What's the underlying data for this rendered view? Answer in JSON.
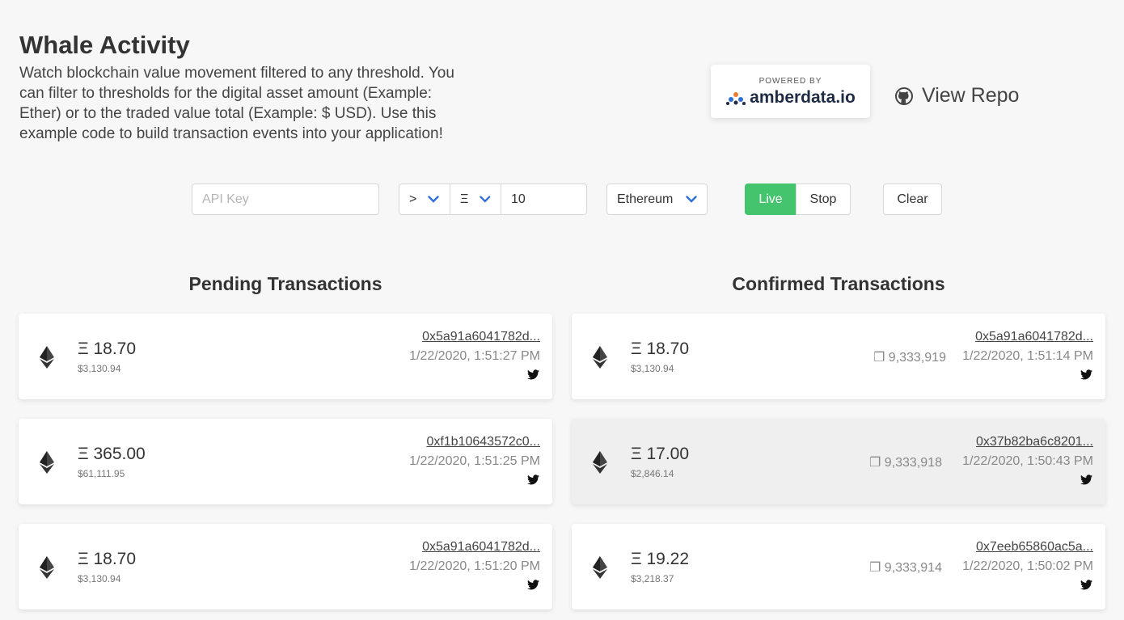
{
  "header": {
    "title": "Whale Activity",
    "description": "Watch blockchain value movement filtered to any threshold. You can filter to thresholds for the digital asset amount (Example: Ether) or to the traded value total (Example: $ USD). Use this example code to build transaction events into your application!"
  },
  "powered": {
    "small": "POWERED BY",
    "brand": "amberdata.io"
  },
  "repo": {
    "label": "View Repo",
    "icon": "github-icon"
  },
  "filters": {
    "api_key_placeholder": "API Key",
    "operator": ">",
    "unit": "Ξ",
    "threshold": "10",
    "network": "Ethereum",
    "live_label": "Live",
    "stop_label": "Stop",
    "clear_label": "Clear"
  },
  "colors": {
    "live": "#44c46d",
    "chevron": "#2f6fd6",
    "background": "#f7f7f7"
  },
  "pending": {
    "title": "Pending Transactions",
    "items": [
      {
        "amount": "Ξ 18.70",
        "usd": "$3,130.94",
        "hash": "0x5a91a6041782d...",
        "time": "1/22/2020, 1:51:27 PM"
      },
      {
        "amount": "Ξ 365.00",
        "usd": "$61,111.95",
        "hash": "0xf1b10643572c0...",
        "time": "1/22/2020, 1:51:25 PM"
      },
      {
        "amount": "Ξ 18.70",
        "usd": "$3,130.94",
        "hash": "0x5a91a6041782d...",
        "time": "1/22/2020, 1:51:20 PM"
      }
    ]
  },
  "confirmed": {
    "title": "Confirmed Transactions",
    "items": [
      {
        "amount": "Ξ 18.70",
        "usd": "$3,130.94",
        "hash": "0x5a91a6041782d...",
        "block": "❐ 9,333,919",
        "time": "1/22/2020, 1:51:14 PM"
      },
      {
        "amount": "Ξ 17.00",
        "usd": "$2,846.14",
        "hash": "0x37b82ba6c8201...",
        "block": "❐ 9,333,918",
        "time": "1/22/2020, 1:50:43 PM"
      },
      {
        "amount": "Ξ 19.22",
        "usd": "$3,218.37",
        "hash": "0x7eeb65860ac5a...",
        "block": "❐ 9,333,914",
        "time": "1/22/2020, 1:50:02 PM"
      }
    ]
  }
}
